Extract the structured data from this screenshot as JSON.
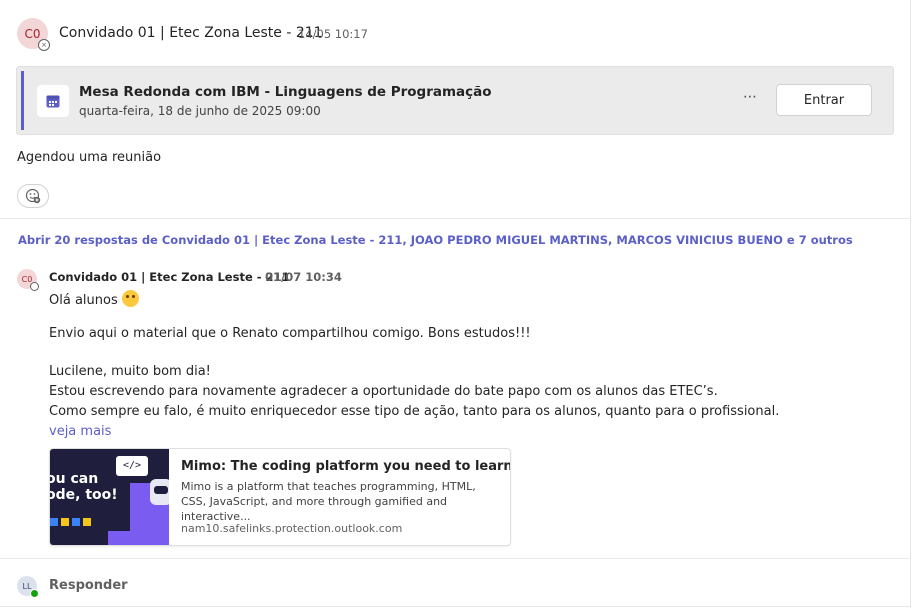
{
  "post": {
    "avatar_initials": "C0",
    "author": "Convidado 01 | Etec Zona Leste - 211",
    "timestamp": "14/05 10:17",
    "meeting": {
      "title": "Mesa Redonda com IBM - Linguagens de Programação",
      "datetime": "quarta-feira, 18 de junho de 2025 09:00",
      "more_label": "⋯",
      "join_label": "Entrar"
    },
    "body": "Agendou uma reunião"
  },
  "thread": {
    "replies_link": "Abrir 20 respostas de Convidado 01 | Etec Zona Leste - 211, JOAO PEDRO MIGUEL MARTINS, MARCOS VINICIUS BUENO e 7 outros",
    "reply": {
      "avatar_initials": "C0",
      "author": "Convidado 01 | Etec Zona Leste - 211",
      "timestamp": "01/07 10:34",
      "lines": [
        "Olá alunos",
        "Envio aqui o material que o Renato compartilhou comigo. Bons estudos!!!",
        "Lucilene, muito bom dia!",
        "Estou escrevendo para novamente agradecer a oportunidade do bate papo com os alunos das ETEC’s.",
        "Como sempre eu falo, é muito enriquecedor esse tipo de ação, tanto para os alunos, quanto para o profissional."
      ],
      "see_more": "veja mais",
      "link_preview": {
        "thumb_text": "ou can\node, too!",
        "thumb_code": "</>",
        "title": "Mimo: The coding platform you need to learn ...",
        "description": "Mimo is a platform that teaches programming, HTML, CSS, JavaScript, and more through gamified and interactive...",
        "url": "nam10.safelinks.protection.outlook.com"
      }
    }
  },
  "composer": {
    "avatar_initials": "LL",
    "reply_label": "Responder"
  },
  "colors": {
    "accent": "#5b5fc7",
    "avatar_bg": "#f3d6d8",
    "online": "#13a10e"
  }
}
